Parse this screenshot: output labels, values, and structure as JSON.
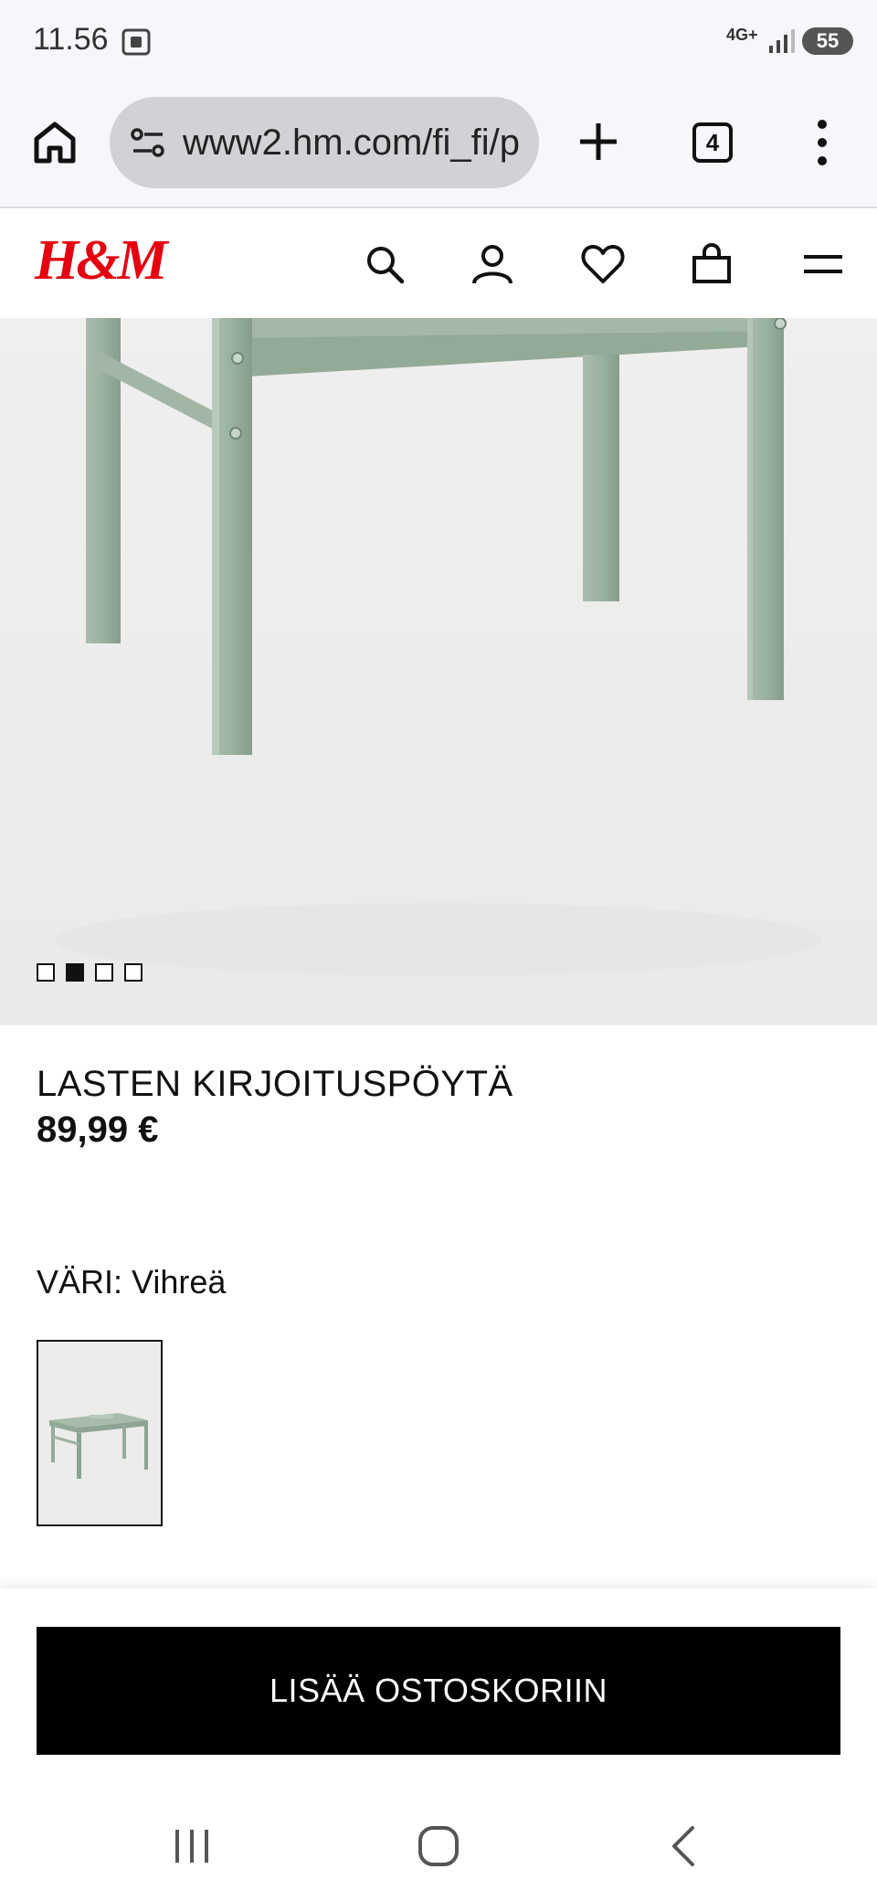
{
  "status_bar": {
    "time": "11.56",
    "network": "4G+",
    "battery": "55"
  },
  "browser": {
    "url": "www2.hm.com/fi_fi/p",
    "tab_count": "4"
  },
  "header": {
    "logo": "H&M",
    "logo_color": "#e50010"
  },
  "carousel": {
    "total": 4,
    "active_index": 2
  },
  "product": {
    "name": "LASTEN KIRJOITUSPÖYTÄ",
    "price": "89,99 €",
    "color_label": "VÄRI: Vihreä",
    "color": "#9fb5a4"
  },
  "cart": {
    "button_label": "LISÄÄ OSTOSKORIIN"
  }
}
